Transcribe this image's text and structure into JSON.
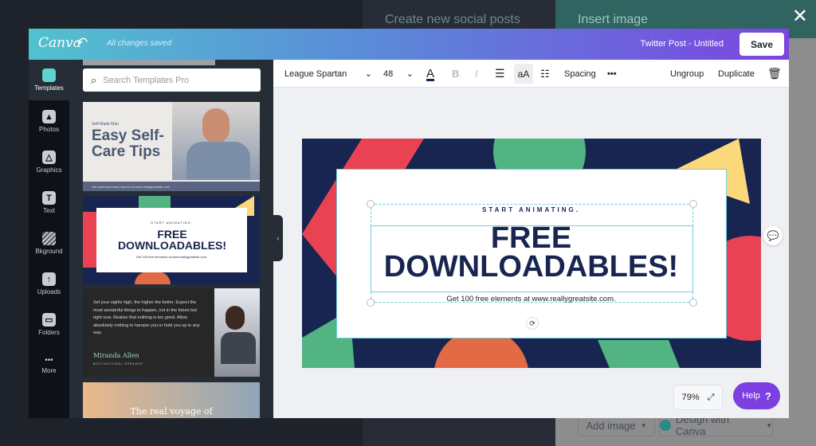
{
  "background": {
    "left_title": "Create new social posts",
    "right_title": "Insert image",
    "add_image": "Add image",
    "design_with_canva": "Design with Canva",
    "close": "✕"
  },
  "header": {
    "logo": "Canva",
    "status": "All changes saved",
    "doc_title": "Twitter Post - Untitled",
    "save": "Save"
  },
  "sidebar": {
    "items": [
      {
        "label": "Templates",
        "icon": "templates-icon"
      },
      {
        "label": "Photos",
        "icon": "photos-icon"
      },
      {
        "label": "Graphics",
        "icon": "graphics-icon"
      },
      {
        "label": "Text",
        "icon": "text-icon"
      },
      {
        "label": "Bkground",
        "icon": "background-icon"
      },
      {
        "label": "Uploads",
        "icon": "uploads-icon"
      },
      {
        "label": "Folders",
        "icon": "folders-icon"
      },
      {
        "label": "More",
        "icon": "more-icon"
      }
    ]
  },
  "panel": {
    "search_placeholder": "Search Templates Pro",
    "templates": [
      {
        "kicker": "Self-Made Man",
        "title": "Easy Self-Care Tips",
        "footer": "Get quick and easy how-tos at www.reallygreatsite.com"
      },
      {
        "kicker": "START ANIMATING.",
        "title": "FREE DOWNLOADABLES!",
        "footer": "Get 100 free elements at www.reallygreatsite.com."
      },
      {
        "quote": "Set your sights high, the higher the better. Expect the most wonderful things to happen, not in the future but right now. Realize that nothing is too good. Allow absolutely nothing to hamper you or hold you up in any way.",
        "name": "Miranda Allen",
        "role": "MOTIVATIONAL SPEAKER"
      },
      {
        "title": "The real voyage of"
      }
    ]
  },
  "toolbar": {
    "font": "League Spartan",
    "size": "48",
    "spacing": "Spacing",
    "more": "•••",
    "ungroup": "Ungroup",
    "duplicate": "Duplicate"
  },
  "design": {
    "kicker": "START ANIMATING.",
    "line1": "FREE",
    "line2": "DOWNLOADABLES!",
    "footer": "Get 100 free elements at www.reallygreatsite.com.",
    "colors": {
      "navy": "#182550",
      "red": "#e84253",
      "green": "#52b482",
      "yellow": "#fbd97a",
      "orange": "#e26a45"
    }
  },
  "footer": {
    "zoom": "79%",
    "help": "Help",
    "help_icon": "?"
  }
}
